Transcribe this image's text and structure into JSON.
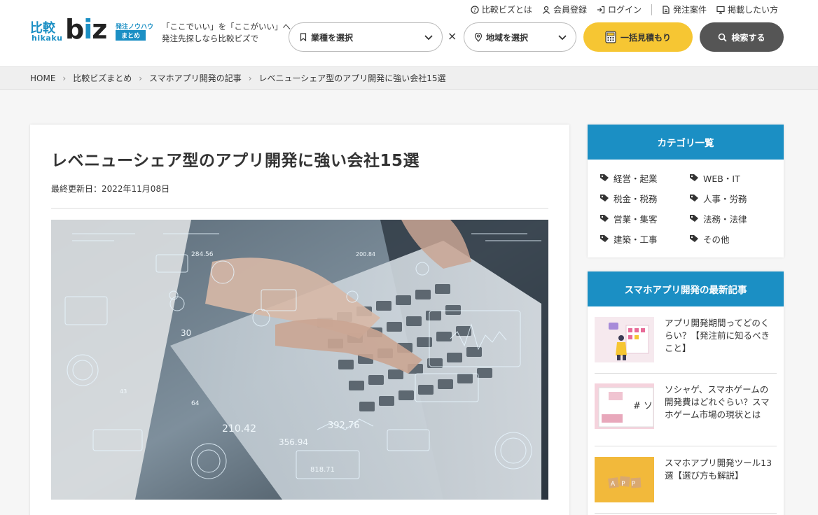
{
  "header": {
    "logo": {
      "hikaku_kanji": "比較",
      "hikaku_romaji": "hikaku",
      "biz_b": "b",
      "biz_i": "i",
      "biz_z": "z",
      "note_top": "発注ノウハウ",
      "note_bottom": "まとめ"
    },
    "tagline_line1": "「ここでいい」を「ここがいい」へ",
    "tagline_line2": "発注先探しなら比較ビズで",
    "top_links": [
      {
        "label": "比較ビズとは",
        "icon": "question-circle-icon"
      },
      {
        "label": "会員登録",
        "icon": "user-icon"
      },
      {
        "label": "ログイン",
        "icon": "login-icon"
      },
      {
        "label": "発注案件",
        "icon": "document-icon"
      },
      {
        "label": "掲載したい方",
        "icon": "monitor-icon"
      }
    ],
    "industry_select": "業種を選択",
    "region_select": "地域を選択",
    "cross": "×",
    "quote_button": "一括見積もり",
    "search_button": "検索する"
  },
  "breadcrumb": [
    "HOME",
    "比較ビズまとめ",
    "スマホアプリ開発の記事",
    "レベニューシェア型のアプリ開発に強い会社15選"
  ],
  "article": {
    "title": "レベニューシェア型のアプリ開発に強い会社15選",
    "updated": "最終更新日：2022年11月08日",
    "hero_alt_labels": [
      "210.42",
      "392.76",
      "356.94",
      "818.71",
      "200.84",
      "284.56",
      "30",
      "64",
      "43"
    ]
  },
  "sidebar": {
    "category_title": "カテゴリ一覧",
    "categories": [
      "経営・起業",
      "WEB・IT",
      "税金・税務",
      "人事・労務",
      "営業・集客",
      "法務・法律",
      "建築・工事",
      "その他"
    ],
    "latest_title": "スマホアプリ開発の最新記事",
    "posts": [
      {
        "title": "アプリ開発期間ってどのくらい？【発注前に知るべきこと】"
      },
      {
        "title": "ソシャゲ、スマホゲームの開発費はどれぐらい？スマホゲーム市場の現状とは",
        "thumb_text": "# ソ"
      },
      {
        "title": "スマホアプリ開発ツール13選【選び方も解説】",
        "thumb_text": "APP"
      }
    ]
  },
  "colors": {
    "brand": "#1b8fc4",
    "quote": "#f6c633",
    "search": "#555555"
  }
}
